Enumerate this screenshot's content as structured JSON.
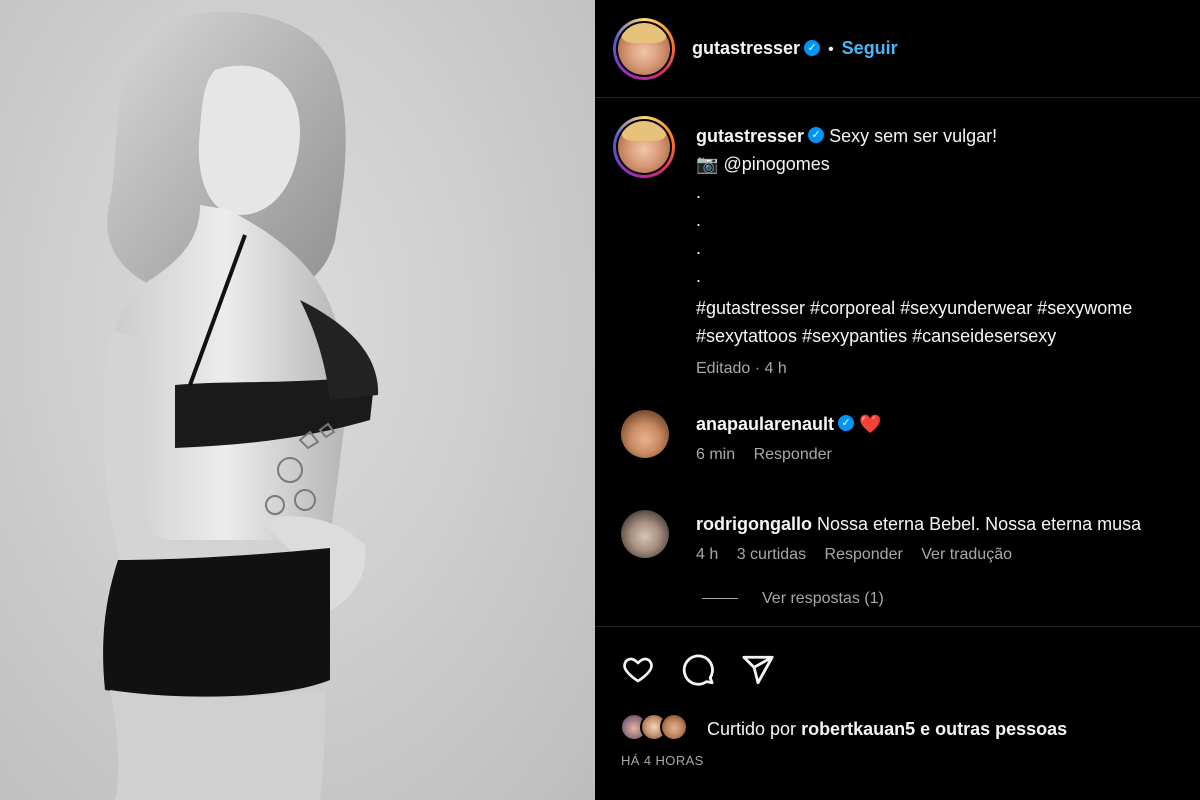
{
  "post": {
    "author": "gutastresser",
    "follow_label": "Seguir",
    "separator": "•",
    "caption_text": "Sexy sem ser vulgar!",
    "credit_emoji": "📷",
    "credit_handle": "@pinogomes",
    "dots": [
      ".",
      ".",
      ".",
      "."
    ],
    "hashtags_line1": "#gutastresser #corporeal #sexyunderwear #sexywome",
    "hashtags_line2": "#sexytattoos #sexypanties #canseidesersexy",
    "edited_meta": "Editado · 4 h"
  },
  "comments": [
    {
      "user": "anapaularenault",
      "text": "❤️",
      "time": "6 min",
      "reply_label": "Responder"
    },
    {
      "user": "rodrigongallo",
      "text": "Nossa eterna Bebel. Nossa eterna musa",
      "time": "4 h",
      "likes": "3 curtidas",
      "reply_label": "Responder",
      "translate_label": "Ver tradução",
      "view_replies_label": "Ver respostas (1)"
    }
  ],
  "actions": {
    "like_icon": "heart-icon",
    "comment_icon": "comment-icon",
    "share_icon": "share-icon",
    "liked_by_prefix": "Curtido por",
    "liked_by_user": "robertkauan5",
    "liked_by_suffix": "e outras pessoas",
    "timestamp": "HÁ 4 HORAS"
  },
  "colors": {
    "background": "#000000",
    "link_blue": "#4db5f9",
    "verified_blue": "#0095f6",
    "muted_text": "#a8a8a8",
    "divider": "#262626"
  }
}
